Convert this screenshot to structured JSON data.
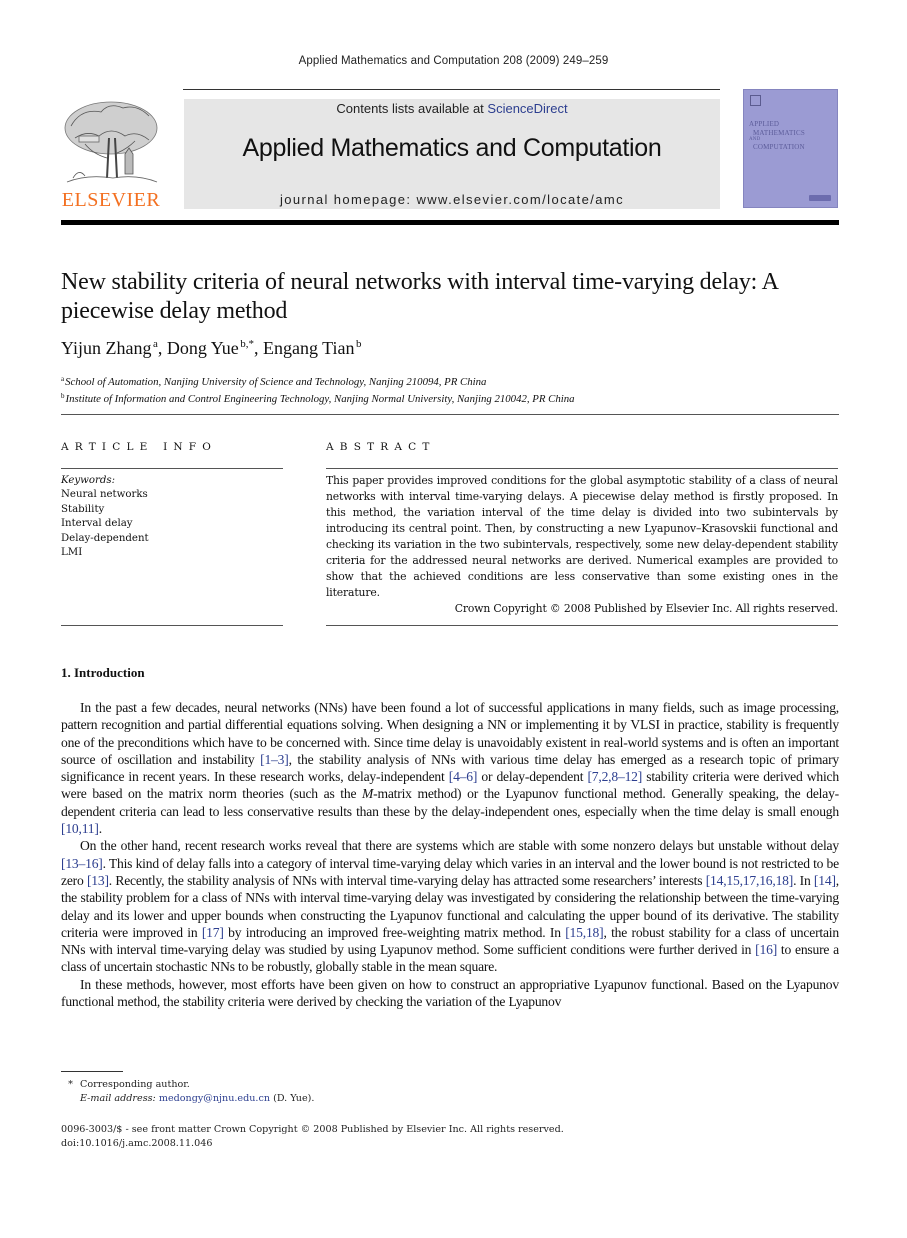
{
  "running_head": "Applied Mathematics and Computation 208 (2009) 249–259",
  "masthead": {
    "publisher_logo_text": "ELSEVIER",
    "contents_prefix": "Contents lists available at ",
    "contents_link": "ScienceDirect",
    "journal_title": "Applied Mathematics and Computation",
    "homepage": "journal homepage: www.elsevier.com/locate/amc",
    "cover_title_lines": [
      "APPLIED",
      "MATHEMATICS",
      "AND",
      "COMPUTATION"
    ],
    "colors": {
      "elsevier_orange": "#f37021",
      "link_blue": "#2c3e8f",
      "banner_gray": "#e6e6e6",
      "cover_purple": "#9b9bd3"
    }
  },
  "article": {
    "title": "New stability criteria of neural networks with interval time-varying delay: A piecewise delay method",
    "authors": [
      {
        "name": "Yijun Zhang",
        "sup": "a"
      },
      {
        "name": "Dong Yue",
        "sup": "b,*"
      },
      {
        "name": "Engang Tian",
        "sup": "b"
      }
    ],
    "affiliations": [
      {
        "mark": "a",
        "text": "School of Automation, Nanjing University of Science and Technology, Nanjing 210094, PR China"
      },
      {
        "mark": "b",
        "text": "Institute of Information and Control Engineering Technology, Nanjing Normal University, Nanjing 210042, PR China"
      }
    ]
  },
  "article_info": {
    "heading": "ARTICLE INFO",
    "keywords_label": "Keywords:",
    "keywords": [
      "Neural networks",
      "Stability",
      "Interval delay",
      "Delay-dependent",
      "LMI"
    ]
  },
  "abstract": {
    "heading": "ABSTRACT",
    "text": "This paper provides improved conditions for the global asymptotic stability of a class of neural networks with interval time-varying delays. A piecewise delay method is firstly proposed. In this method, the variation interval of the time delay is divided into two subintervals by introducing its central point. Then, by constructing a new Lyapunov–Krasovskii functional and checking its variation in the two subintervals, respectively, some new delay-dependent stability criteria for the addressed neural networks are derived. Numerical examples are provided to show that the achieved conditions are less conservative than some existing ones in the literature.",
    "copyright": "Crown Copyright © 2008 Published by Elsevier Inc. All rights reserved."
  },
  "introduction": {
    "heading": "1.  Introduction",
    "paragraphs": [
      [
        {
          "t": "In the past a few decades, neural networks (NNs) have been found a lot of successful applications in many fields, such as image processing, pattern recognition and partial differential equations solving. When designing a NN or implementing it by VLSI in practice, stability is frequently one of the preconditions which have to be concerned with. Since time delay is unavoidably existent in real-world systems and is often an important source of oscillation and instability "
        },
        {
          "ref": "[1–3]"
        },
        {
          "t": ", the stability analysis of NNs with various time delay has emerged as a research topic of primary significance in recent years. In these research works, delay-independent "
        },
        {
          "ref": "[4–6]"
        },
        {
          "t": " or delay-dependent "
        },
        {
          "ref": "[7,2,8–12]"
        },
        {
          "t": " stability criteria were derived which were based on the matrix norm theories (such as the "
        },
        {
          "it": "M"
        },
        {
          "t": "-matrix method) or the Lyapunov functional method. Generally speaking, the delay-dependent criteria can lead to less conservative results than these by the delay-independent ones, especially when the time delay is small enough "
        },
        {
          "ref": "[10,11]"
        },
        {
          "t": "."
        }
      ],
      [
        {
          "t": "On the other hand, recent research works reveal that there are systems which are stable with some nonzero delays but unstable without delay "
        },
        {
          "ref": "[13–16]"
        },
        {
          "t": ". This kind of delay falls into a category of interval time-varying delay which varies in an interval and the lower bound is not restricted to be zero "
        },
        {
          "ref": "[13]"
        },
        {
          "t": ". Recently, the stability analysis of NNs with interval time-varying delay has attracted some researchers’ interests "
        },
        {
          "ref": "[14,15,17,16,18]"
        },
        {
          "t": ". In "
        },
        {
          "ref": "[14]"
        },
        {
          "t": ", the stability problem for a class of NNs with interval time-varying delay was investigated by considering the relationship between the time-varying delay and its lower and upper bounds when constructing the Lyapunov functional and calculating the upper bound of its derivative. The stability criteria were improved in "
        },
        {
          "ref": "[17]"
        },
        {
          "t": " by introducing an improved free-weighting matrix method. In "
        },
        {
          "ref": "[15,18]"
        },
        {
          "t": ", the robust stability for a class of uncertain NNs with interval time-varying delay was studied by using Lyapunov method. Some sufficient conditions were further derived in "
        },
        {
          "ref": "[16]"
        },
        {
          "t": " to ensure a class of uncertain stochastic NNs to be robustly, globally stable in the mean square."
        }
      ],
      [
        {
          "t": "In these methods, however, most efforts have been given on how to construct an appropriative Lyapunov functional. Based on the Lyapunov functional method, the stability criteria were derived by checking the variation of the Lyapunov"
        }
      ]
    ]
  },
  "footnotes": {
    "corresponding_mark": "*",
    "corresponding_text": "Corresponding author.",
    "email_label": "E-mail address:",
    "email": "medongy@njnu.edu.cn",
    "email_suffix": " (D. Yue).",
    "issn_line": "0096-3003/$ - see front matter Crown Copyright © 2008 Published by Elsevier Inc. All rights reserved.",
    "doi": "doi:10.1016/j.amc.2008.11.046"
  }
}
